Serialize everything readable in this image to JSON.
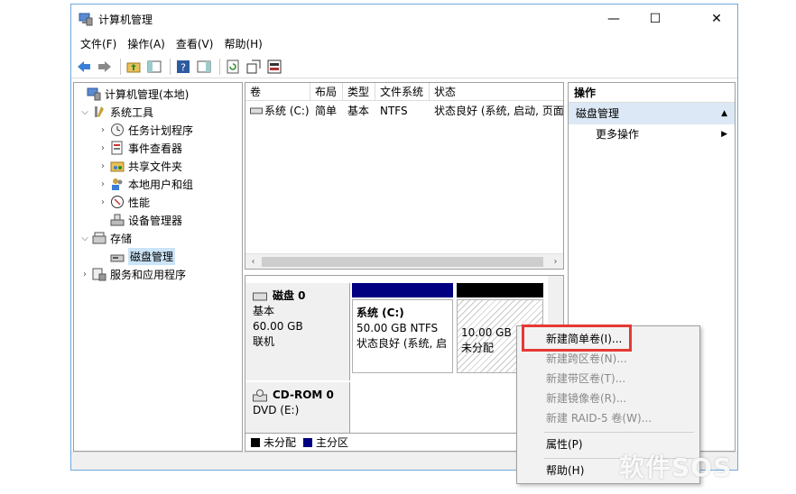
{
  "window": {
    "title": "计算机管理",
    "controls": {
      "minimize": "—",
      "maximize": "☐",
      "close": "✕"
    }
  },
  "menubar": [
    "文件(F)",
    "操作(A)",
    "查看(V)",
    "帮助(H)"
  ],
  "tree": {
    "root": "计算机管理(本地)",
    "system_tools": "系统工具",
    "task_scheduler": "任务计划程序",
    "event_viewer": "事件查看器",
    "shared_folders": "共享文件夹",
    "local_users": "本地用户和组",
    "performance": "性能",
    "device_manager": "设备管理器",
    "storage": "存储",
    "disk_management": "磁盘管理",
    "services_apps": "服务和应用程序"
  },
  "volume_list": {
    "columns": [
      "卷",
      "布局",
      "类型",
      "文件系统",
      "状态"
    ],
    "rows": [
      {
        "volume": "系统 (C:)",
        "layout": "简单",
        "type": "基本",
        "fs": "NTFS",
        "status": "状态良好 (系统, 启动, 页面"
      }
    ]
  },
  "disks": {
    "disk0": {
      "name": "磁盘 0",
      "type": "基本",
      "size": "60.00 GB",
      "state": "联机"
    },
    "part_c": {
      "name": "系统  (C:)",
      "size": "50.00 GB NTFS",
      "status": "状态良好 (系统, 启"
    },
    "part_unalloc": {
      "size": "10.00 GB",
      "status": "未分配"
    },
    "cdrom": {
      "name": "CD-ROM 0",
      "drive": "DVD (E:)"
    },
    "legend_unallocated": "未分配",
    "legend_primary": "主分区",
    "colors": {
      "primary": "#000080",
      "unallocated": "#000000"
    }
  },
  "actions": {
    "header": "操作",
    "section": "磁盘管理",
    "more": "更多操作"
  },
  "context_menu": {
    "new_simple": "新建简单卷(I)...",
    "new_spanned": "新建跨区卷(N)...",
    "new_striped": "新建带区卷(T)...",
    "new_mirrored": "新建镜像卷(R)...",
    "new_raid5": "新建 RAID-5 卷(W)...",
    "properties": "属性(P)",
    "help": "帮助(H)"
  },
  "watermark": "软件SOS"
}
